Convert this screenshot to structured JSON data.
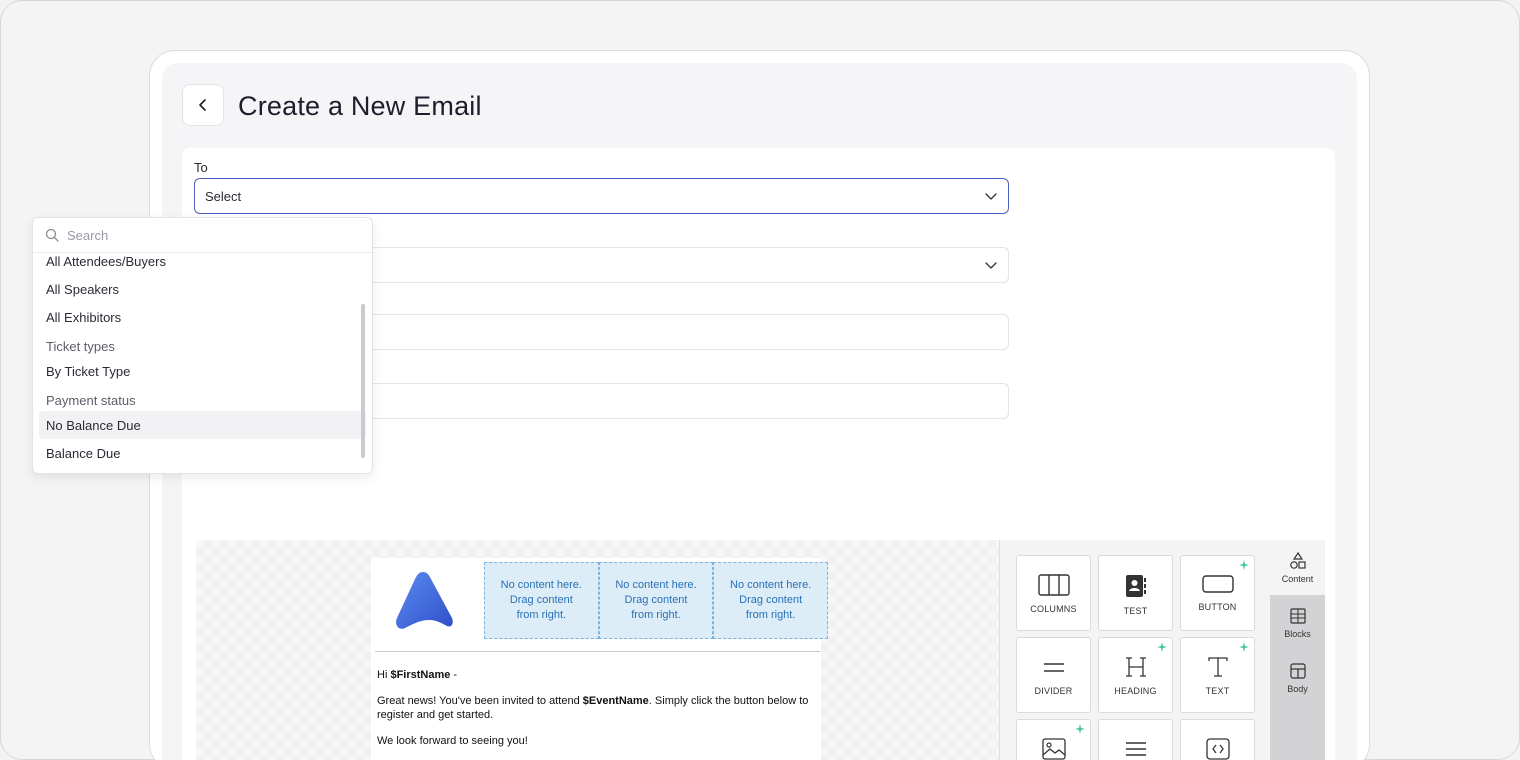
{
  "header": {
    "title": "Create a New Email",
    "back_icon": "chevron-left-icon"
  },
  "form": {
    "to_label": "To",
    "to_value": "Select"
  },
  "dropdown": {
    "search_placeholder": "Search",
    "items": [
      {
        "label": "All Attendees/Buyers",
        "type": "item"
      },
      {
        "label": "All Speakers",
        "type": "item"
      },
      {
        "label": "All Exhibitors",
        "type": "item"
      },
      {
        "label": "Ticket types",
        "type": "group"
      },
      {
        "label": "By Ticket Type",
        "type": "item"
      },
      {
        "label": "Payment status",
        "type": "group"
      },
      {
        "label": "No Balance Due",
        "type": "item"
      },
      {
        "label": "Balance Due",
        "type": "item"
      }
    ]
  },
  "email": {
    "placeholder_line1": "No content here.",
    "placeholder_line2": "Drag content",
    "placeholder_line3": "from right.",
    "greeting_prefix": "Hi ",
    "greeting_var": "$FirstName",
    "greeting_suffix": " -",
    "body_prefix": "Great news! You've been invited to attend ",
    "body_var": "$EventName",
    "body_suffix": ". Simply click the button below to register and get started.",
    "closing": "We look forward to seeing you!"
  },
  "tools": {
    "tiles": [
      "COLUMNS",
      "TEST",
      "BUTTON",
      "DIVIDER",
      "HEADING",
      "TEXT"
    ],
    "tabs": [
      "Content",
      "Blocks",
      "Body"
    ]
  },
  "colors": {
    "accent": "#4a5fc1",
    "placeholder_bg": "#dcedf8",
    "placeholder_text": "#2a6fb5",
    "spark": "#3ec7a0"
  }
}
